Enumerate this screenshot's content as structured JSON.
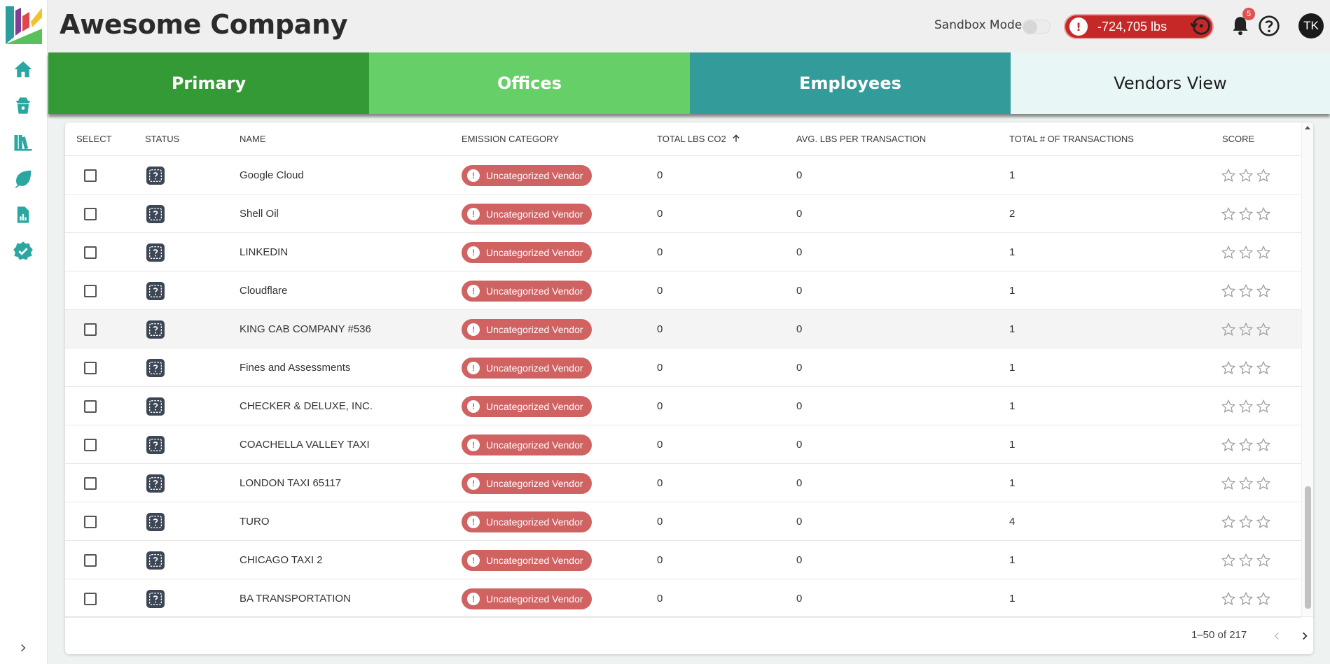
{
  "header": {
    "company_name": "Awesome Company",
    "sandbox_label": "Sandbox Mode",
    "sandbox_enabled": false,
    "emissions_value": "-724,705 lbs",
    "emissions_alert_glyph": "!",
    "notification_count": "5",
    "user_initials": "TK"
  },
  "sidebar": {
    "items": [
      {
        "icon": "home-icon"
      },
      {
        "icon": "shopping-basket-icon"
      },
      {
        "icon": "library-books-icon"
      },
      {
        "icon": "leaf-icon"
      },
      {
        "icon": "report-chart-icon"
      },
      {
        "icon": "verified-check-icon"
      }
    ],
    "expand_icon": "chevron-right-icon"
  },
  "tabs": [
    {
      "label": "Primary"
    },
    {
      "label": "Offices"
    },
    {
      "label": "Employees"
    },
    {
      "label": "Vendors View"
    }
  ],
  "table": {
    "columns": {
      "select": "SELECT",
      "status": "STATUS",
      "name": "NAME",
      "category": "EMISSION CATEGORY",
      "total_lbs": "TOTAL LBS CO2",
      "avg_lbs": "AVG. LBS PER TRANSACTION",
      "transactions": "TOTAL # OF TRANSACTIONS",
      "score": "SCORE"
    },
    "sort_icon": "arrow-up-icon",
    "category_alert_glyph": "!",
    "rows": [
      {
        "name": "Google Cloud",
        "category": "Uncategorized Vendor",
        "total_lbs": "0",
        "avg_lbs": "0",
        "transactions": "1",
        "score": 0
      },
      {
        "name": "Shell Oil",
        "category": "Uncategorized Vendor",
        "total_lbs": "0",
        "avg_lbs": "0",
        "transactions": "2",
        "score": 0
      },
      {
        "name": "LINKEDIN",
        "category": "Uncategorized Vendor",
        "total_lbs": "0",
        "avg_lbs": "0",
        "transactions": "1",
        "score": 0
      },
      {
        "name": "Cloudflare",
        "category": "Uncategorized Vendor",
        "total_lbs": "0",
        "avg_lbs": "0",
        "transactions": "1",
        "score": 0
      },
      {
        "name": "KING CAB COMPANY #536",
        "category": "Uncategorized Vendor",
        "total_lbs": "0",
        "avg_lbs": "0",
        "transactions": "1",
        "score": 0
      },
      {
        "name": "Fines and Assessments",
        "category": "Uncategorized Vendor",
        "total_lbs": "0",
        "avg_lbs": "0",
        "transactions": "1",
        "score": 0
      },
      {
        "name": "CHECKER & DELUXE, INC.",
        "category": "Uncategorized Vendor",
        "total_lbs": "0",
        "avg_lbs": "0",
        "transactions": "1",
        "score": 0
      },
      {
        "name": "COACHELLA VALLEY TAXI",
        "category": "Uncategorized Vendor",
        "total_lbs": "0",
        "avg_lbs": "0",
        "transactions": "1",
        "score": 0
      },
      {
        "name": "LONDON TAXI 65117",
        "category": "Uncategorized Vendor",
        "total_lbs": "0",
        "avg_lbs": "0",
        "transactions": "1",
        "score": 0
      },
      {
        "name": "TURO",
        "category": "Uncategorized Vendor",
        "total_lbs": "0",
        "avg_lbs": "0",
        "transactions": "4",
        "score": 0
      },
      {
        "name": "CHICAGO TAXI 2",
        "category": "Uncategorized Vendor",
        "total_lbs": "0",
        "avg_lbs": "0",
        "transactions": "1",
        "score": 0
      },
      {
        "name": "BA TRANSPORTATION",
        "category": "Uncategorized Vendor",
        "total_lbs": "0",
        "avg_lbs": "0",
        "transactions": "1",
        "score": 0
      }
    ]
  },
  "pagination": {
    "range_text": "1–50 of 217"
  },
  "colors": {
    "tab_primary": "#339a35",
    "tab_offices": "#67cf67",
    "tab_employees": "#339b9a",
    "tab_vendors": "#e9f6f6",
    "alert_red": "#c62828",
    "category_pill": "#d06262",
    "sidebar_icon": "#2aa7a0"
  }
}
